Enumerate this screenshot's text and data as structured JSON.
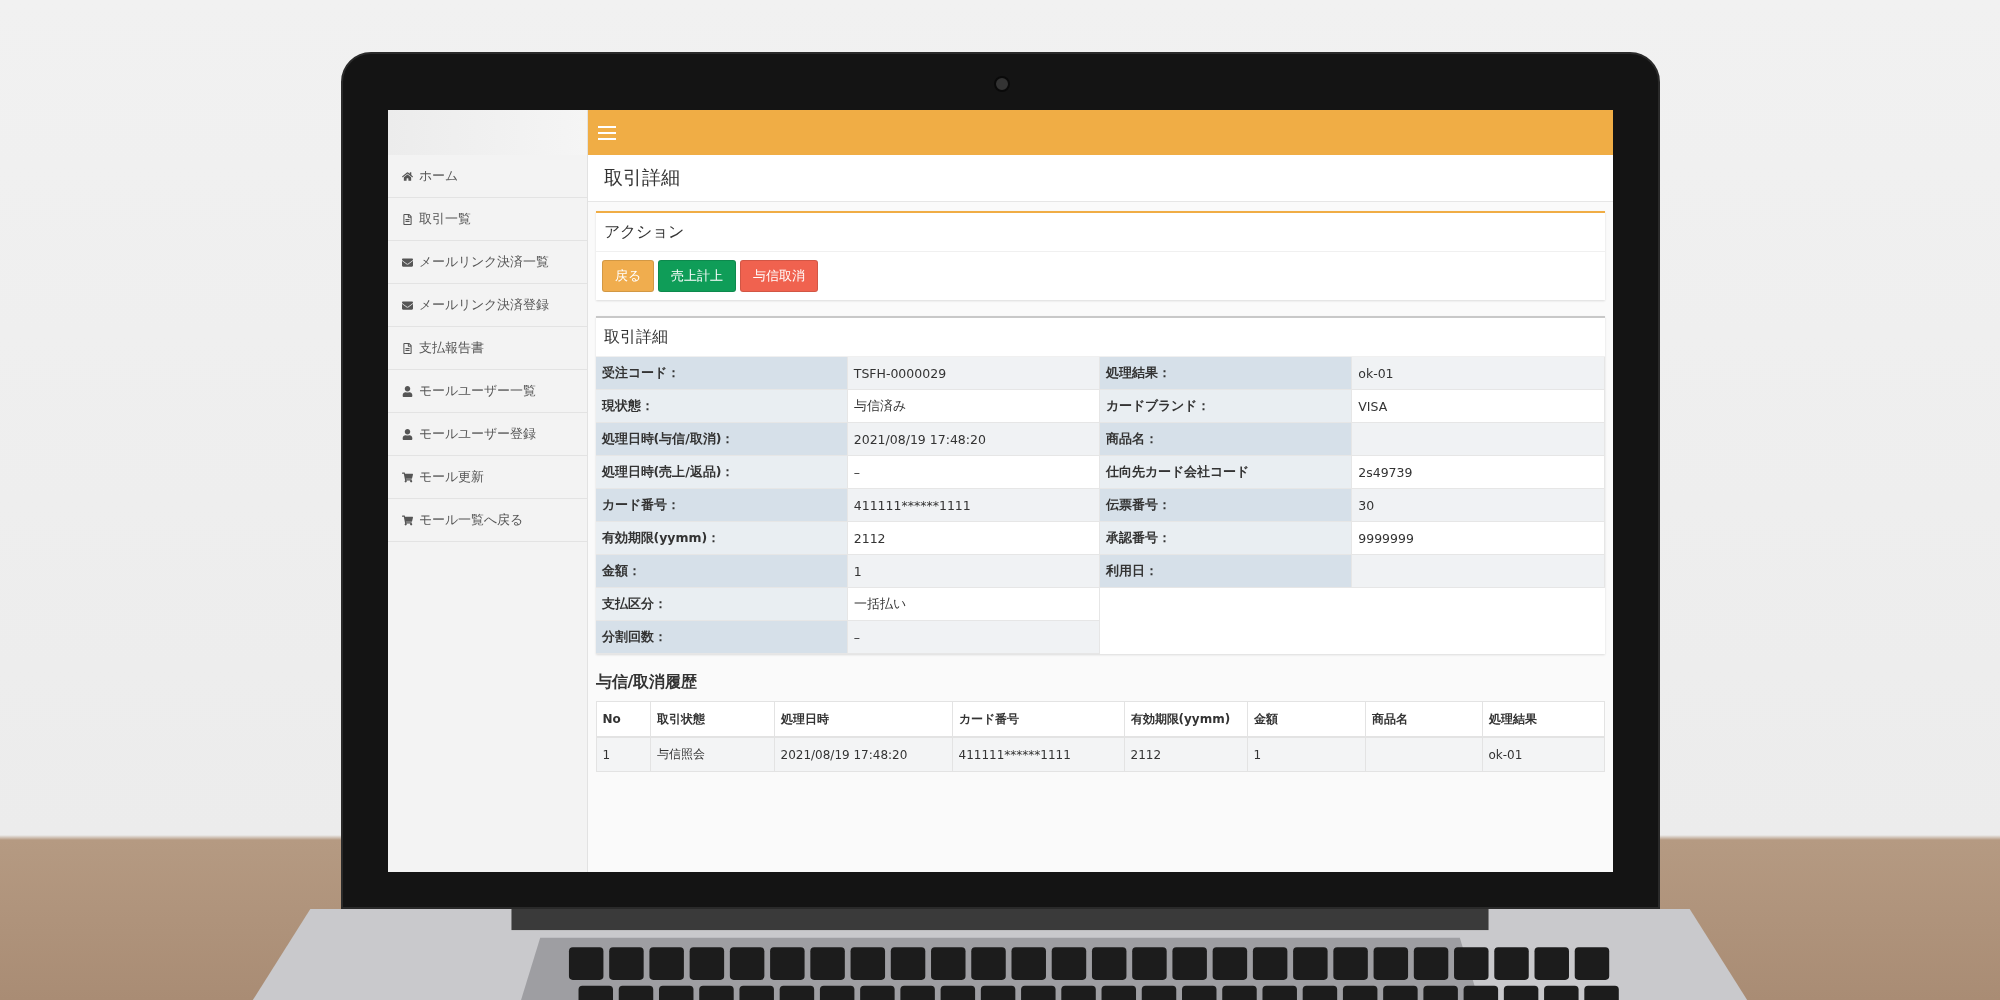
{
  "sidebar": {
    "items": [
      {
        "kind": "home",
        "label": "ホーム"
      },
      {
        "kind": "file",
        "label": "取引一覧"
      },
      {
        "kind": "mail",
        "label": "メールリンク決済一覧"
      },
      {
        "kind": "mail",
        "label": "メールリンク決済登録"
      },
      {
        "kind": "file",
        "label": "支払報告書"
      },
      {
        "kind": "user",
        "label": "モールユーザー一覧"
      },
      {
        "kind": "user",
        "label": "モールユーザー登録"
      },
      {
        "kind": "cart",
        "label": "モール更新"
      },
      {
        "kind": "cart",
        "label": "モール一覧へ戻る"
      }
    ]
  },
  "page_title": "取引詳細",
  "action_panel": {
    "title": "アクション",
    "buttons": [
      {
        "label": "戻る",
        "color": "#f0ad4e"
      },
      {
        "label": "売上計上",
        "color": "#0f9d58"
      },
      {
        "label": "与信取消",
        "color": "#f0624f"
      }
    ]
  },
  "detail_panel": {
    "title": "取引詳細",
    "left": [
      {
        "label": "受注コード：",
        "value": "TSFH-0000029"
      },
      {
        "label": "現状態：",
        "value": "与信済み"
      },
      {
        "label": "処理日時(与信/取消)：",
        "value": "2021/08/19 17:48:20"
      },
      {
        "label": "処理日時(売上/返品)：",
        "value": "–"
      },
      {
        "label": "カード番号：",
        "value": "411111******1111"
      },
      {
        "label": "有効期限(yymm)：",
        "value": "2112"
      },
      {
        "label": "金額：",
        "value": "1"
      },
      {
        "label": "支払区分：",
        "value": "一括払い"
      },
      {
        "label": "分割回数：",
        "value": "–"
      }
    ],
    "right": [
      {
        "label": "処理結果：",
        "value": "ok-01"
      },
      {
        "label": "カードブランド：",
        "value": "VISA"
      },
      {
        "label": "商品名："
      },
      {
        "label": "仕向先カード会社コード",
        "value": "2s49739"
      },
      {
        "label": "伝票番号：",
        "value": "30"
      },
      {
        "label": "承認番号：",
        "value": "9999999"
      },
      {
        "label": "利用日："
      }
    ]
  },
  "history": {
    "title": "与信/取消履歴",
    "columns": [
      "No",
      "取引状態",
      "処理日時",
      "カード番号",
      "有効期限(yymm)",
      "金額",
      "商品名",
      "処理結果"
    ],
    "rows": [
      [
        "1",
        "与信照会",
        "2021/08/19 17:48:20",
        "411111******1111",
        "2112",
        "1",
        "",
        "ok-01"
      ]
    ]
  }
}
